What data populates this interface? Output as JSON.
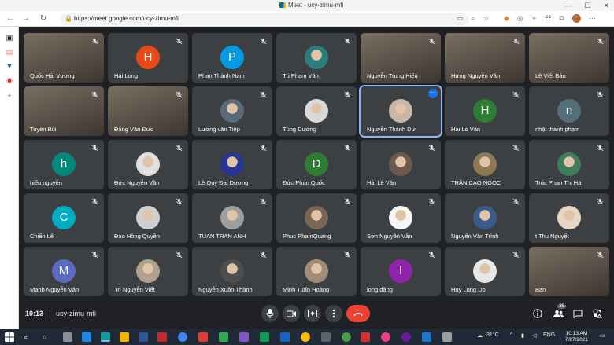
{
  "browser": {
    "tab_title": "Meet - ucy-zimu-mfi",
    "url": "https://meet.google.com/ucy-zimu-mfi",
    "window_controls": [
      "—",
      "☐",
      "✕"
    ]
  },
  "colors": {
    "accent": "#1a73e8",
    "end_call": "#ea4335",
    "tile_bg": "#3c4043",
    "page_bg": "#202124"
  },
  "participants": [
    {
      "name": "Quốc Hải Vương",
      "type": "video",
      "muted": true
    },
    {
      "name": "Hải Long",
      "type": "letter",
      "letter": "H",
      "color": "#e64a19",
      "muted": true
    },
    {
      "name": "Phan Thành Nam",
      "type": "letter",
      "letter": "P",
      "color": "#039be5",
      "muted": true
    },
    {
      "name": "Tú Phạm Văn",
      "type": "photo",
      "color": "#2e7d7d",
      "muted": true
    },
    {
      "name": "Nguyễn Trung Hiếu",
      "type": "video",
      "muted": true
    },
    {
      "name": "Hưng Nguyễn Văn",
      "type": "video",
      "muted": true
    },
    {
      "name": "Lê Viết Bảo",
      "type": "video",
      "muted": true
    },
    {
      "name": "Tuyền Bùi",
      "type": "video",
      "muted": true
    },
    {
      "name": "Đặng Văn Đức",
      "type": "video",
      "muted": true
    },
    {
      "name": "Lương văn Tiệp",
      "type": "photo",
      "color": "#5b6b7a",
      "muted": true
    },
    {
      "name": "Tùng Dương",
      "type": "photo",
      "color": "#d9d9d9",
      "muted": true
    },
    {
      "name": "Nguyễn Thành Dư",
      "type": "photo",
      "color": "#c9b7a5",
      "muted": false,
      "active": true
    },
    {
      "name": "Hải Lò Văn",
      "type": "letter",
      "letter": "H",
      "color": "#2e7d32",
      "muted": true
    },
    {
      "name": "nhật thành phạm",
      "type": "letter",
      "letter": "n",
      "color": "#546e7a",
      "muted": true
    },
    {
      "name": "hiếu nguyễn",
      "type": "letter",
      "letter": "h",
      "color": "#00897b",
      "muted": true
    },
    {
      "name": "Đức Nguyễn Văn",
      "type": "photo",
      "color": "#e0e0e0",
      "muted": true
    },
    {
      "name": "Lê Quý Đại Dương",
      "type": "photo",
      "color": "#283593",
      "muted": true
    },
    {
      "name": "Đức Phan Quốc",
      "type": "letter",
      "letter": "Đ",
      "color": "#2e7d32",
      "muted": true
    },
    {
      "name": "Hải Lê Văn",
      "type": "photo",
      "color": "#6d5a4f",
      "muted": true
    },
    {
      "name": "TRẦN CAO NGỌC",
      "type": "photo",
      "color": "#8d7a55",
      "muted": true
    },
    {
      "name": "Trúc Phan Thị Hà",
      "type": "photo",
      "color": "#3f7d5a",
      "muted": true
    },
    {
      "name": "Chiến Lê",
      "type": "letter",
      "letter": "C",
      "color": "#00acc1",
      "muted": true
    },
    {
      "name": "Đào Hồng Quyền",
      "type": "photo",
      "color": "#cfcfcf",
      "muted": true
    },
    {
      "name": "TUAN TRAN ANH",
      "type": "photo",
      "color": "#9e9e9e",
      "muted": true
    },
    {
      "name": "Phuc PhamQuang",
      "type": "photo",
      "color": "#7b6654",
      "muted": true
    },
    {
      "name": "Sơn Nguyễn Văn",
      "type": "photo",
      "color": "#f5f5f5",
      "muted": true
    },
    {
      "name": "Nguyễn Văn Trình",
      "type": "photo",
      "color": "#3a5a8a",
      "muted": true
    },
    {
      "name": "t Thu Nguyệt",
      "type": "photo",
      "color": "#e8d6c4",
      "muted": true
    },
    {
      "name": "Mạnh Nguyễn Văn",
      "type": "letter",
      "letter": "M",
      "color": "#5c6bc0",
      "muted": true
    },
    {
      "name": "Trí Nguyễn Viết",
      "type": "photo",
      "color": "#b0a090",
      "muted": true
    },
    {
      "name": "Nguyễn Xuân Thành",
      "type": "photo",
      "color": "#4e4e4e",
      "muted": true
    },
    {
      "name": "Minh Tuấn Hoàng",
      "type": "photo",
      "color": "#a08c78",
      "muted": true
    },
    {
      "name": "long đặng",
      "type": "letter",
      "letter": "l",
      "color": "#8e24aa",
      "muted": true
    },
    {
      "name": "Huy Long Do",
      "type": "photo",
      "color": "#e8e8e8",
      "muted": true
    },
    {
      "name": "Bạn",
      "type": "video",
      "muted": true
    }
  ],
  "bottom_bar": {
    "time": "10:13",
    "meeting_code": "ucy-zimu-mfi",
    "participant_count": "35"
  },
  "taskbar": {
    "weather": "31°C",
    "language": "ENG",
    "time": "10:13 AM",
    "date": "7/27/2021"
  }
}
